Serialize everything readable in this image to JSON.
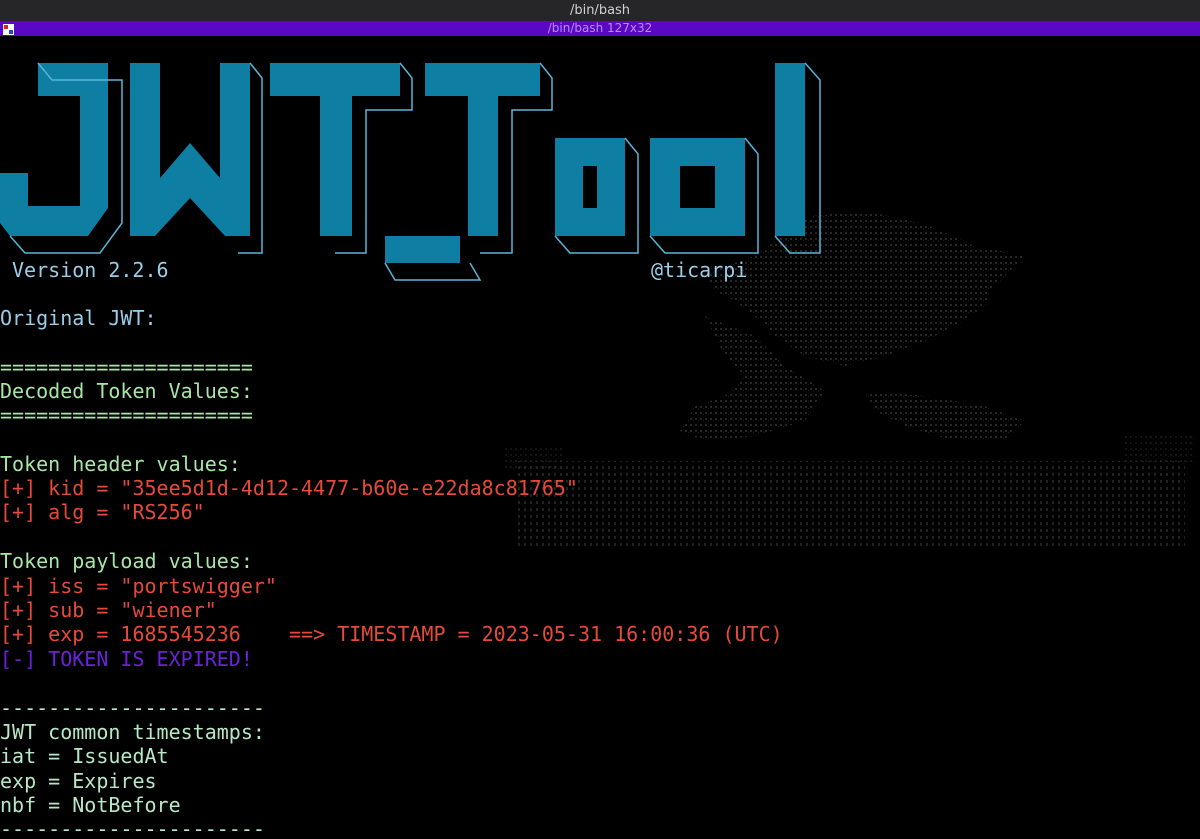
{
  "window": {
    "title": "/bin/bash",
    "tab_title": "/bin/bash 127x32"
  },
  "logo": {
    "text": "JWT_Tool",
    "version": "Version 2.2.6",
    "author": "@ticarpi"
  },
  "lines": {
    "original_jwt": "Original JWT:",
    "separator_eq": "=====================",
    "decoded_heading": "Decoded Token Values:",
    "header_heading": "Token header values:",
    "kid": "[+] kid = \"35ee5d1d-4d12-4477-b60e-e22da8c81765\"",
    "alg": "[+] alg = \"RS256\"",
    "payload_heading": "Token payload values:",
    "iss": "[+] iss = \"portswigger\"",
    "sub": "[+] sub = \"wiener\"",
    "exp": "[+] exp = 1685545236    ==> TIMESTAMP = 2023-05-31 16:00:36 (UTC)",
    "expired": "[-] TOKEN IS EXPIRED!",
    "separator_dash": "----------------------",
    "common_heading": "JWT common timestamps:",
    "iat_def": "iat = IssuedAt",
    "exp_def": "exp = Expires",
    "nbf_def": "nbf = NotBefore"
  },
  "colors": {
    "logo": "#0e7ea3",
    "tab_bar": "#5a08c4",
    "info": "#a8e6a8",
    "values": "#e64a3a",
    "warning": "#6b22d9"
  }
}
